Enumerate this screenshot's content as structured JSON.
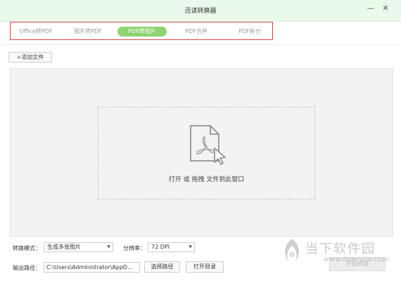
{
  "window": {
    "title": "迅读转换器",
    "minimize": "—",
    "close": "✕"
  },
  "tabs": [
    {
      "label": "Office转PDF"
    },
    {
      "label": "图片转PDF"
    },
    {
      "label": "PDF转图片"
    },
    {
      "label": "PDF合并"
    },
    {
      "label": "PDF拆分"
    }
  ],
  "toolbar": {
    "add_file_label": "+添加文件"
  },
  "dropzone": {
    "text": "打开 或 拖拽 文件到此窗口",
    "icon": "pdf-file-icon"
  },
  "settings": {
    "mode_label": "转换模式：",
    "mode_value": "生成多张图片",
    "resolution_label": "分辨率：",
    "resolution_value": "72 DPI",
    "output_label": "输出路径：",
    "output_path": "C:\\Users\\Administrator\\AppD...",
    "choose_path_label": "选择路径",
    "open_dir_label": "打开目录",
    "convert_label": "开始转换"
  },
  "watermark": {
    "text": "当下软件园",
    "url": "www.downxia.com"
  },
  "colors": {
    "accent": "#8ed36f",
    "titlebar": "#eafaea",
    "highlight_border": "#dd4444"
  }
}
